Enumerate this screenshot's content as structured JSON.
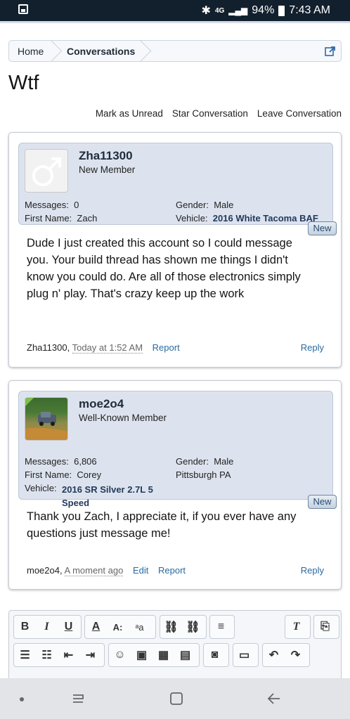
{
  "status_bar": {
    "battery": "94%",
    "time": "7:43 AM",
    "network": "4G"
  },
  "breadcrumb": {
    "home": "Home",
    "current": "Conversations"
  },
  "page_title": "Wtf",
  "actions": {
    "mark_unread": "Mark as Unread",
    "star": "Star Conversation",
    "leave": "Leave Conversation"
  },
  "messages": [
    {
      "username": "Zha11300",
      "user_title": "New Member",
      "messages_label": "Messages:",
      "messages_count": "0",
      "gender_label": "Gender:",
      "gender": "Male",
      "first_name_label": "First Name:",
      "first_name": "Zach",
      "vehicle_label": "Vehicle:",
      "vehicle": "2016 White Tacoma BAF",
      "new_badge": "New",
      "body": "Dude I just created this account so I could message you. Your build thread has shown me things I didn't know you could do. Are all of those electronics simply plug n' play. That's crazy keep up the work",
      "author": "Zha11300,",
      "date": "Today at 1:52 AM",
      "report": "Report",
      "reply": "Reply"
    },
    {
      "username": "moe2o4",
      "user_title": "Well-Known Member",
      "messages_label": "Messages:",
      "messages_count": "6,806",
      "gender_label": "Gender:",
      "gender": "Male",
      "first_name_label": "First Name:",
      "first_name": "Corey",
      "location": "Pittsburgh PA",
      "vehicle_label": "Vehicle:",
      "vehicle": "2016 SR Silver 2.7L 5 Speed",
      "new_badge": "New",
      "body": "Thank you Zach, I appreciate it, if you ever have any questions just message me!",
      "author": "moe2o4,",
      "date": "A moment ago",
      "edit": "Edit",
      "report": "Report",
      "reply": "Reply"
    }
  ],
  "editor_toolbar": {
    "row1": [
      "B",
      "I",
      "U"
    ],
    "icons": [
      "bold-icon",
      "italic-icon",
      "underline-icon",
      "text-color-icon",
      "font-size-icon",
      "font-family-icon",
      "link-icon",
      "unlink-icon",
      "align-icon",
      "remove-format-icon",
      "toggle-bbcode-icon",
      "bullet-list-icon",
      "numbered-list-icon",
      "outdent-icon",
      "indent-icon",
      "smilie-icon",
      "image-icon",
      "media-icon",
      "quote-icon",
      "camera-icon",
      "save-icon",
      "undo-icon",
      "redo-icon"
    ]
  },
  "colors": {
    "status_bar": "#12202e",
    "userinfo_bg": "#dde3ee",
    "link": "#2a6aa0",
    "username": "#1f2c3d"
  }
}
